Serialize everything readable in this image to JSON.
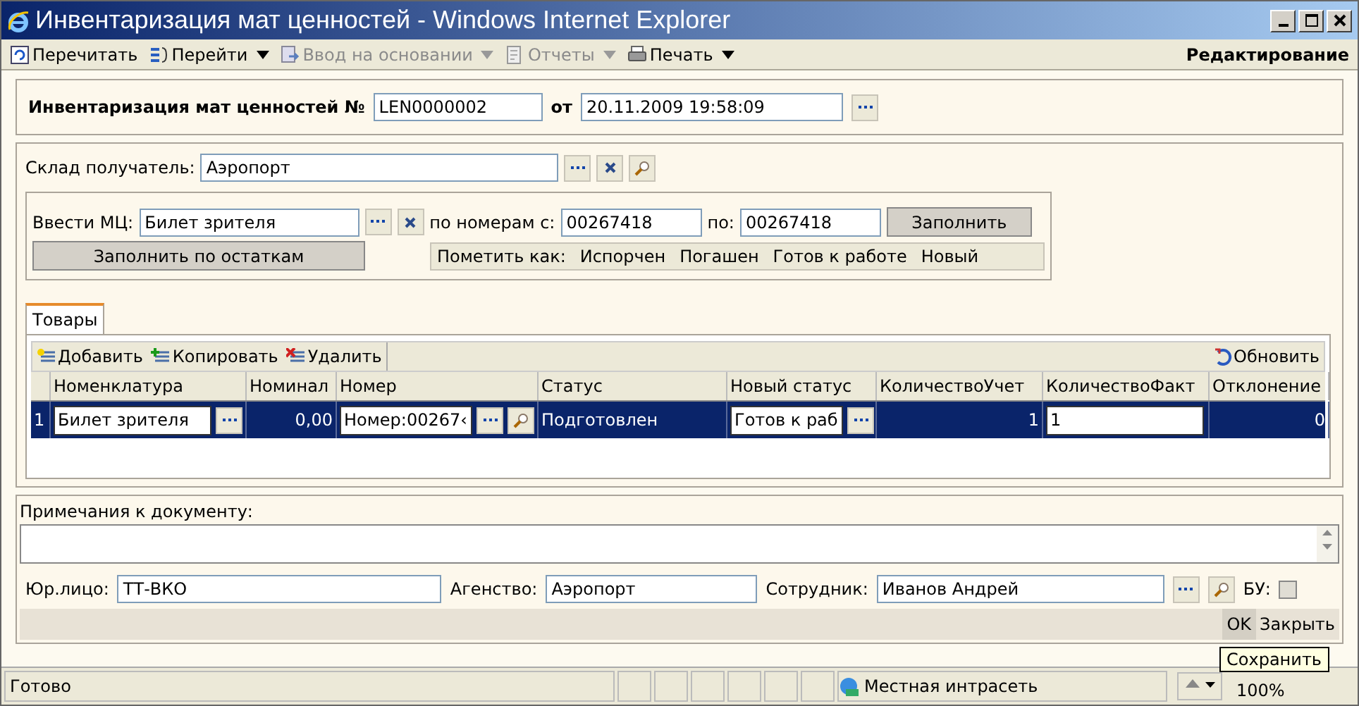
{
  "window": {
    "title": "Инвентаризация мат ценностей - Windows Internet Explorer"
  },
  "toolbar": {
    "items": [
      {
        "label": "Перечитать",
        "disabled": false,
        "menu": false,
        "kind": "reload"
      },
      {
        "label": "Перейти",
        "disabled": false,
        "menu": true,
        "kind": "goto"
      },
      {
        "label": "Ввод на основании",
        "disabled": true,
        "menu": true,
        "kind": "enter"
      },
      {
        "label": "Отчеты",
        "disabled": true,
        "menu": true,
        "kind": "reports"
      },
      {
        "label": "Печать",
        "disabled": false,
        "menu": true,
        "kind": "print"
      }
    ],
    "mode": "Редактирование"
  },
  "header": {
    "label": "Инвентаризация мат ценностей №",
    "number": "LEN0000002",
    "date_label": "от",
    "date": "20.11.2009 19:58:09"
  },
  "warehouse": {
    "label": "Склад получатель:",
    "value": "Аэропорт"
  },
  "fill_group": {
    "label": "Ввести МЦ:",
    "value": "Билет зрителя",
    "from_label": "по номерам с:",
    "from": "00267418",
    "to_label": "по:",
    "to": "00267418",
    "fill_button": "Заполнить",
    "fill_rest_button": "Заполнить по остаткам",
    "mark_label": "Пометить как:",
    "mark_options": [
      "Испорчен",
      "Погашен",
      "Готов к работе",
      "Новый"
    ]
  },
  "tabs": [
    {
      "label": "Товары",
      "selected": true
    }
  ],
  "grid": {
    "actions": [
      {
        "label": "Добавить",
        "kind": "add"
      },
      {
        "label": "Копировать",
        "kind": "copy"
      },
      {
        "label": "Удалить",
        "kind": "delete"
      }
    ],
    "refresh": "Обновить",
    "columns": [
      "Номенклатура",
      "Номинал",
      "Номер",
      "Статус",
      "Новый статус",
      "КоличествоУчет",
      "КоличествоФакт",
      "Отклонение"
    ],
    "rows": [
      {
        "index": "1",
        "nomenclature": "Билет зрителя",
        "nominal": "0,00",
        "number": "Номер:00267‹",
        "status": "Подготовлен",
        "new_status": "Готов к раб",
        "qty_account": "1",
        "qty_fact": "1",
        "deviation": "0",
        "selected": true
      }
    ]
  },
  "notes": {
    "label": "Примечания к документу:"
  },
  "fields": [
    {
      "label": "Юр.лицо:",
      "value": "ТТ-ВКО"
    },
    {
      "label": "Агенство:",
      "value": "Аэропорт"
    },
    {
      "label": "Сотрудник:",
      "value": "Иванов Андрей"
    }
  ],
  "bu": {
    "label": "БУ:",
    "checked": false
  },
  "buttons": [
    "OK",
    "Закрыть"
  ],
  "tooltip": "Сохранить",
  "status_bar": {
    "text": "Готово",
    "zone": "Местная интрасеть",
    "zoom": "100%"
  }
}
